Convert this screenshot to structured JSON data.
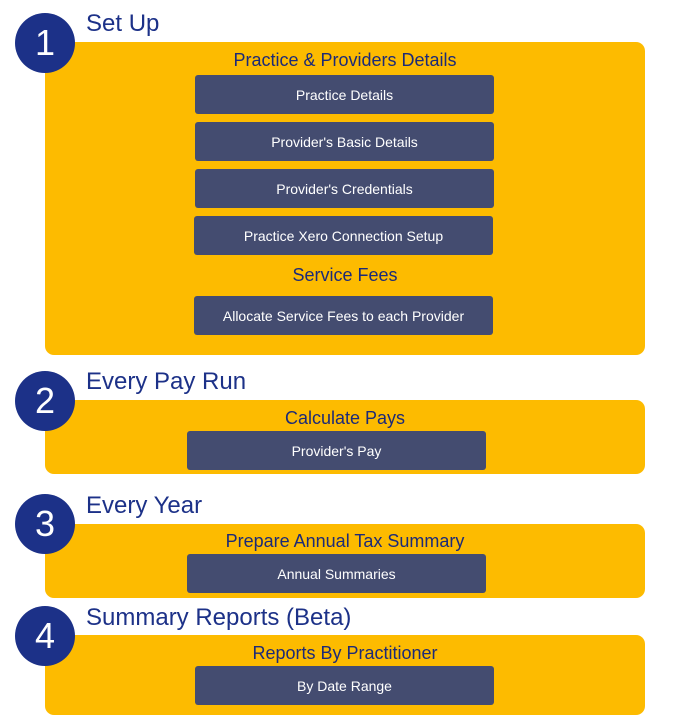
{
  "colors": {
    "badge": "#1c3188",
    "title": "#1c3188",
    "panel": "#fdbb00",
    "button": "#444c70",
    "button_text": "#ffffff"
  },
  "sections": [
    {
      "number": "1",
      "title": "Set Up",
      "groups": [
        {
          "heading": "Practice & Providers Details",
          "buttons": [
            "Practice Details",
            "Provider's Basic Details",
            "Provider's Credentials",
            "Practice Xero Connection Setup"
          ]
        },
        {
          "heading": "Service Fees",
          "buttons": [
            "Allocate Service Fees to each Provider"
          ]
        }
      ]
    },
    {
      "number": "2",
      "title": "Every Pay Run",
      "groups": [
        {
          "heading": "Calculate Pays",
          "buttons": [
            "Provider's Pay"
          ]
        }
      ]
    },
    {
      "number": "3",
      "title": "Every Year",
      "groups": [
        {
          "heading": "Prepare Annual Tax Summary",
          "buttons": [
            "Annual Summaries"
          ]
        }
      ]
    },
    {
      "number": "4",
      "title": "Summary Reports (Beta)",
      "groups": [
        {
          "heading": "Reports By Practitioner",
          "buttons": [
            "By Date Range"
          ]
        }
      ]
    }
  ]
}
